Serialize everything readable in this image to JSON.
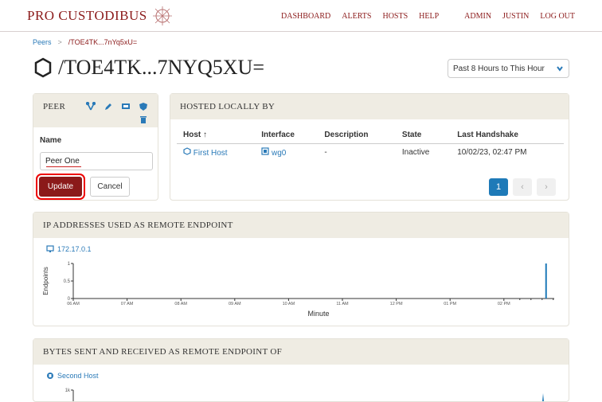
{
  "brand": {
    "name": "PRO CUSTODIBUS"
  },
  "nav": {
    "items": [
      "DASHBOARD",
      "ALERTS",
      "HOSTS",
      "HELP"
    ],
    "user_items": [
      "ADMIN",
      "JUSTIN",
      "LOG OUT"
    ]
  },
  "breadcrumb": {
    "root": "Peers",
    "sep": ">",
    "current": "/TOE4TK...7nYq5xU="
  },
  "page": {
    "title": "/TOE4TK...7NYQ5XU=",
    "range": "Past 8 Hours to This Hour"
  },
  "peer_panel": {
    "heading": "PEER",
    "name_label": "Name",
    "name_value": "Peer One",
    "update_label": "Update",
    "cancel_label": "Cancel"
  },
  "hosted": {
    "heading": "HOSTED LOCALLY BY",
    "columns": [
      "Host ↑",
      "Interface",
      "Description",
      "State",
      "Last Handshake"
    ],
    "rows": [
      {
        "host": "First Host",
        "interface": "wg0",
        "description": "-",
        "state": "Inactive",
        "handshake": "10/02/23, 02:47 PM"
      }
    ],
    "pager": {
      "current": "1",
      "prev": "‹",
      "next": "›"
    }
  },
  "ip_panel": {
    "heading": "IP ADDRESSES USED AS REMOTE ENDPOINT",
    "legend": "172.17.0.1"
  },
  "bytes_panel": {
    "heading": "BYTES SENT AND RECEIVED AS REMOTE ENDPOINT OF",
    "legend": "Second Host"
  },
  "chart_data": [
    {
      "type": "bar",
      "ylabel": "Endpoints",
      "xlabel": "Minute",
      "ylim": [
        0,
        1
      ],
      "yticks": [
        "0",
        "0.5",
        "1"
      ],
      "categories": [
        "06 AM",
        "07 AM",
        "08 AM",
        "09 AM",
        "10 AM",
        "11 AM",
        "12 PM",
        "01 PM",
        "02 PM"
      ],
      "series": [
        {
          "name": "172.17.0.1",
          "values": [
            {
              "x": "02:47 PM",
              "y": 1
            }
          ]
        }
      ]
    },
    {
      "type": "bar",
      "yticks": [
        "1k"
      ],
      "series": [
        {
          "name": "Second Host",
          "values": []
        }
      ]
    }
  ],
  "colors": {
    "brand": "#8b1a1a",
    "accent": "#2a7ab8",
    "panel_head": "#efece3"
  }
}
